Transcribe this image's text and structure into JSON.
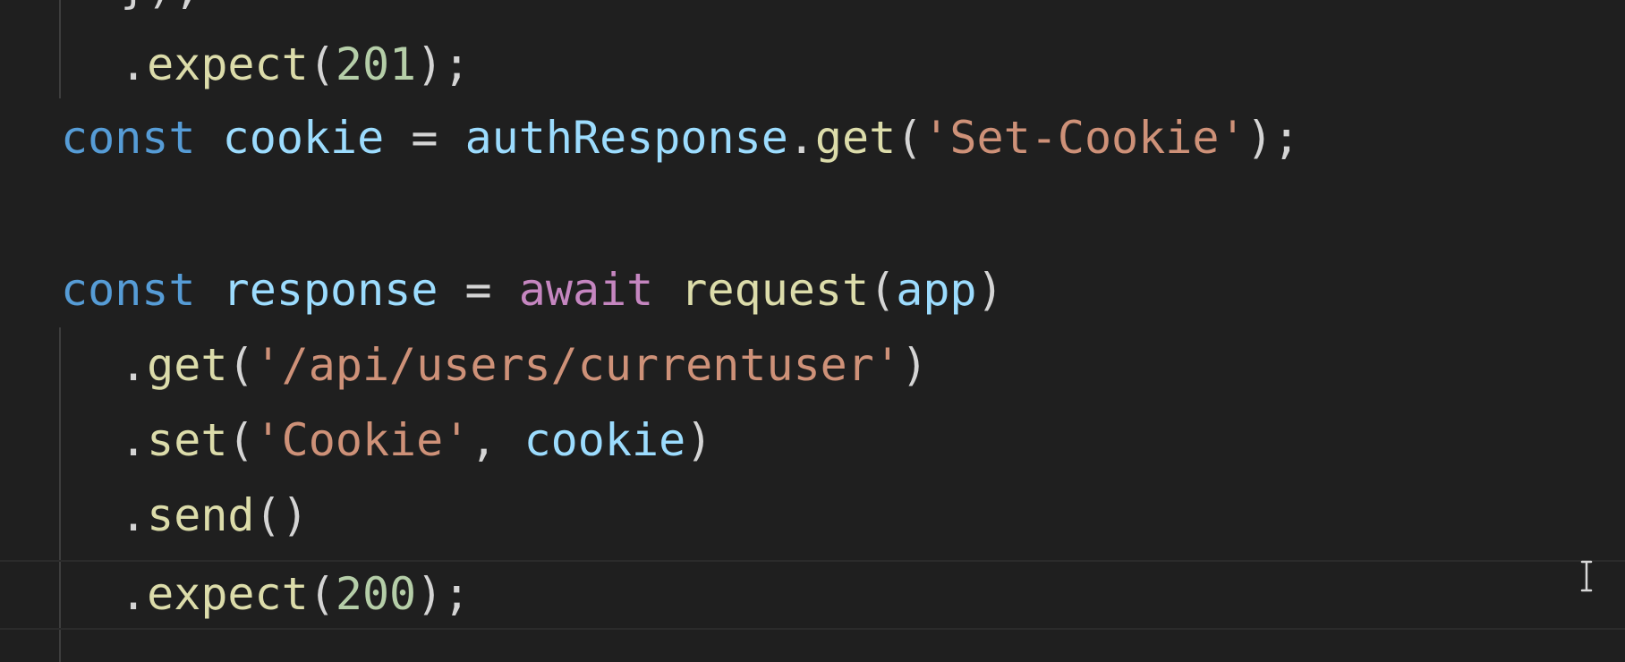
{
  "editor": {
    "top_fragment": "});",
    "lines": [
      {
        "tokens": [
          {
            "t": "punct",
            "v": "."
          },
          {
            "t": "fn",
            "v": "expect"
          },
          {
            "t": "punct",
            "v": "("
          },
          {
            "t": "num",
            "v": "201"
          },
          {
            "t": "punct",
            "v": ");"
          }
        ]
      },
      {
        "tokens": [
          {
            "t": "keyword",
            "v": "const"
          },
          {
            "t": "punct",
            "v": " "
          },
          {
            "t": "var",
            "v": "cookie"
          },
          {
            "t": "punct",
            "v": " = "
          },
          {
            "t": "var",
            "v": "authResponse"
          },
          {
            "t": "punct",
            "v": "."
          },
          {
            "t": "fn",
            "v": "get"
          },
          {
            "t": "punct",
            "v": "("
          },
          {
            "t": "str",
            "v": "'Set-Cookie'"
          },
          {
            "t": "punct",
            "v": ");"
          }
        ]
      },
      {
        "tokens": [
          {
            "t": "keyword",
            "v": "const"
          },
          {
            "t": "punct",
            "v": " "
          },
          {
            "t": "var",
            "v": "response"
          },
          {
            "t": "punct",
            "v": " = "
          },
          {
            "t": "await",
            "v": "await"
          },
          {
            "t": "punct",
            "v": " "
          },
          {
            "t": "fn",
            "v": "request"
          },
          {
            "t": "punct",
            "v": "("
          },
          {
            "t": "var",
            "v": "app"
          },
          {
            "t": "punct",
            "v": ")"
          }
        ]
      },
      {
        "tokens": [
          {
            "t": "punct",
            "v": "."
          },
          {
            "t": "fn",
            "v": "get"
          },
          {
            "t": "punct",
            "v": "("
          },
          {
            "t": "str",
            "v": "'/api/users/currentuser'"
          },
          {
            "t": "punct",
            "v": ")"
          }
        ]
      },
      {
        "tokens": [
          {
            "t": "punct",
            "v": "."
          },
          {
            "t": "fn",
            "v": "set"
          },
          {
            "t": "punct",
            "v": "("
          },
          {
            "t": "str",
            "v": "'Cookie'"
          },
          {
            "t": "punct",
            "v": ", "
          },
          {
            "t": "var",
            "v": "cookie"
          },
          {
            "t": "punct",
            "v": ")"
          }
        ]
      },
      {
        "tokens": [
          {
            "t": "punct",
            "v": "."
          },
          {
            "t": "fn",
            "v": "send"
          },
          {
            "t": "punct",
            "v": "()"
          }
        ]
      },
      {
        "tokens": [
          {
            "t": "punct",
            "v": "."
          },
          {
            "t": "fn",
            "v": "expect"
          },
          {
            "t": "punct",
            "v": "("
          },
          {
            "t": "num",
            "v": "200"
          },
          {
            "t": "punct",
            "v": ");"
          }
        ]
      }
    ],
    "icons": {
      "mouse_cursor": "i-beam-cursor-icon"
    }
  }
}
